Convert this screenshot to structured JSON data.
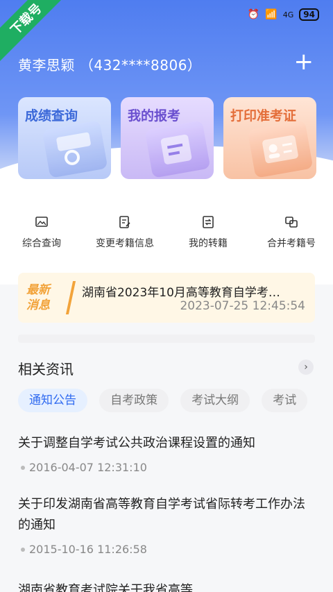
{
  "ribbon": "下载号",
  "status": {
    "battery": "94",
    "network": "4G"
  },
  "user": {
    "name": "黄李思颖",
    "id": "（432****8806）"
  },
  "header": {
    "add_label": "+"
  },
  "cards": [
    {
      "label": "成绩查询"
    },
    {
      "label": "我的报考"
    },
    {
      "label": "打印准考证"
    }
  ],
  "quick": [
    {
      "label": "综合查询",
      "icon": "image-icon"
    },
    {
      "label": "变更考籍信息",
      "icon": "edit-doc-icon"
    },
    {
      "label": "我的转籍",
      "icon": "transfer-doc-icon"
    },
    {
      "label": "合并考籍号",
      "icon": "merge-icon"
    }
  ],
  "news": {
    "badge_line1": "最新",
    "badge_line2": "消息",
    "title": "湖南省2023年10月高等教育自学考…",
    "time": "2023-07-25 12:45:54"
  },
  "section": {
    "title": "相关资讯",
    "arrow": "›"
  },
  "tabs": [
    {
      "label": "通知公告",
      "active": true
    },
    {
      "label": "自考政策",
      "active": false
    },
    {
      "label": "考试大纲",
      "active": false
    },
    {
      "label": "考试",
      "active": false
    }
  ],
  "articles": [
    {
      "title": "关于调整自学考试公共政治课程设置的通知",
      "date": "2016-04-07 12:31:10"
    },
    {
      "title": "关于印发湖南省高等教育自学考试省际转考工作办法的通知",
      "date": "2015-10-16 11:26:58"
    },
    {
      "title": "湖南省教育考试院关于我省高等",
      "date": ""
    }
  ]
}
